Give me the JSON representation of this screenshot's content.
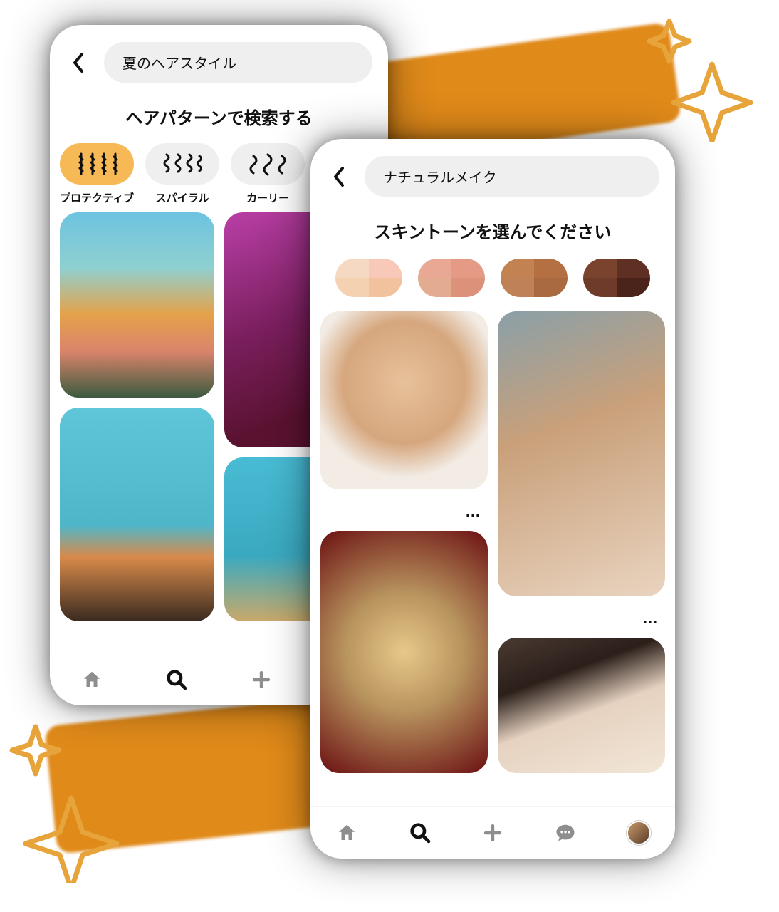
{
  "decor": {
    "sparkle_color": "#e6a43a"
  },
  "phone_left": {
    "search_value": "夏のヘアスタイル",
    "section_title": "ヘアパターンで検索する",
    "hair_chips": [
      {
        "label": "プロテクティブ",
        "icon": "braids-icon",
        "active": true
      },
      {
        "label": "スパイラル",
        "icon": "spiral-icon",
        "active": false
      },
      {
        "label": "カーリー",
        "icon": "curly-icon",
        "active": false
      }
    ],
    "nav": {
      "items": [
        {
          "name": "home",
          "active": false
        },
        {
          "name": "search",
          "active": true
        },
        {
          "name": "create",
          "active": false
        },
        {
          "name": "chat",
          "active": false
        }
      ]
    }
  },
  "phone_right": {
    "search_value": "ナチュラルメイク",
    "section_title": "スキントーンを選んでください",
    "skin_tones": [
      {
        "colors": [
          "#f6d9c3",
          "#f8c9b8",
          "#f4d1b0",
          "#f2c19e"
        ]
      },
      {
        "colors": [
          "#e9a893",
          "#e59a86",
          "#e3ab8f",
          "#dc917b"
        ]
      },
      {
        "colors": [
          "#c38251",
          "#b47042",
          "#be8256",
          "#a96a3f"
        ]
      },
      {
        "colors": [
          "#7a432e",
          "#5e2f22",
          "#6e3a29",
          "#4a241b"
        ]
      }
    ],
    "pin_menu_glyph": "…",
    "nav": {
      "items": [
        {
          "name": "home",
          "active": false
        },
        {
          "name": "search",
          "active": true
        },
        {
          "name": "create",
          "active": false
        },
        {
          "name": "chat",
          "active": false
        },
        {
          "name": "profile",
          "active": false
        }
      ]
    }
  }
}
